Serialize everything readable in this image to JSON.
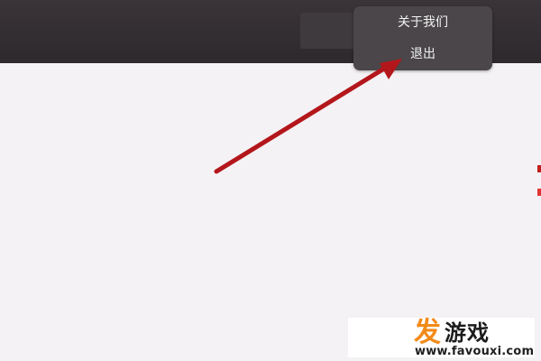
{
  "menu": {
    "items": [
      {
        "label": "关于我们"
      },
      {
        "label": "退出"
      }
    ]
  },
  "annotation": {
    "arrow_color": "#b3161b"
  },
  "watermark": {
    "logo_text": "发",
    "brand_text": "游戏",
    "url": "www.favouxi.com"
  },
  "colors": {
    "title_bar": "#2d292c",
    "menu_background": "#4a4649",
    "content_background": "#f4f2f4",
    "watermark_orange": "#f28a18"
  }
}
